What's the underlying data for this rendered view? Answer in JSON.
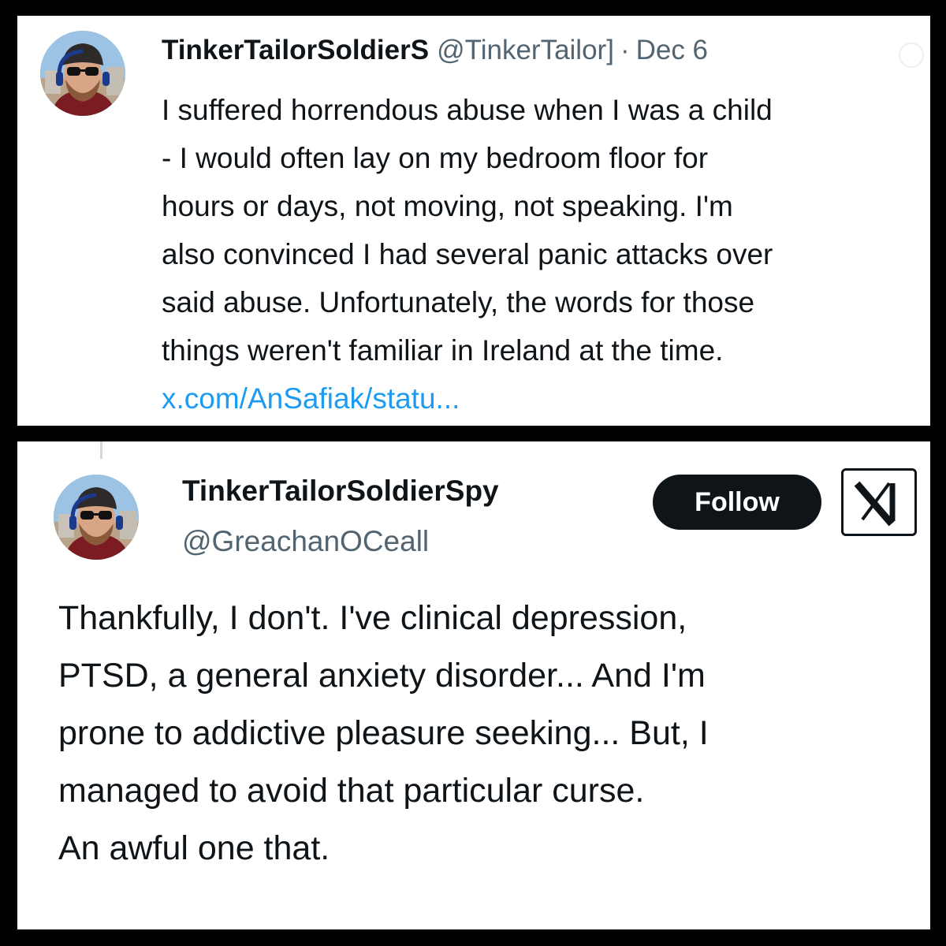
{
  "top_tweet": {
    "display_name": "TinkerTailorSoldierS",
    "handle": "@TinkerTailor]",
    "separator": "·",
    "date": "Dec 6",
    "text_lines": [
      "I suffered horrendous abuse when I was a child",
      "- I would often lay on my bedroom floor for",
      "hours or days, not moving, not speaking. I'm",
      "also convinced I had several panic attacks over",
      "said abuse. Unfortunately, the words for those",
      "things weren't familiar in Ireland at the time."
    ],
    "link": "x.com/AnSafiak/statu..."
  },
  "bottom_tweet": {
    "display_name": "TinkerTailorSoldierSpy",
    "handle": "@GreachanOCeall",
    "follow_label": "Follow",
    "logo": "x-logo-icon",
    "text_lines": [
      "Thankfully, I don't. I've clinical depression,",
      "PTSD, a general anxiety disorder... And I'm",
      "prone to addictive pleasure seeking... But, I",
      "managed to avoid that particular curse.",
      "An awful one that."
    ]
  },
  "colors": {
    "frame": "#000000",
    "card": "#ffffff",
    "text": "#0f1419",
    "secondary": "#536471",
    "link": "#1d9bf0",
    "button": "#0f1419"
  }
}
